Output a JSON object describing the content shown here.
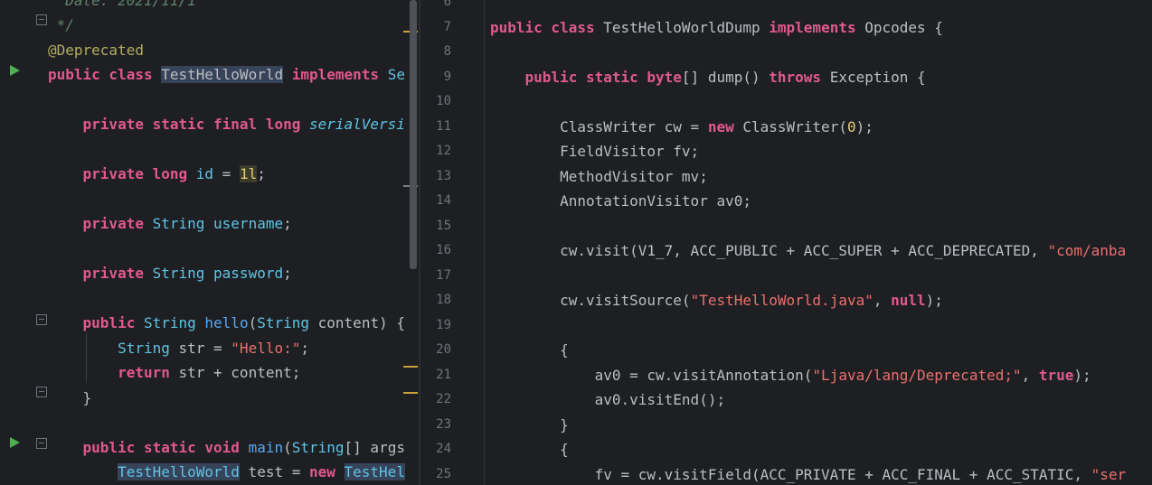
{
  "left_editor": {
    "lines": [
      {
        "parts": [
          {
            "t": "  Date: 2021/11/1",
            "c": "cmt"
          }
        ]
      },
      {
        "parts": [
          {
            "t": " */",
            "c": "cmt"
          }
        ]
      },
      {
        "parts": [
          {
            "t": "@Deprecated",
            "c": "ann"
          }
        ]
      },
      {
        "parts": [
          {
            "t": "public class ",
            "c": "pkw"
          },
          {
            "t": "TestHelloWorld",
            "c": "hl-ref"
          },
          {
            "t": " implements ",
            "c": "pkw"
          },
          {
            "t": "Se",
            "c": "type"
          }
        ]
      },
      {
        "parts": []
      },
      {
        "parts": [
          {
            "t": "    private static final long ",
            "c": "pkw"
          },
          {
            "t": "serialVersi",
            "c": "type ital"
          }
        ]
      },
      {
        "parts": []
      },
      {
        "parts": [
          {
            "t": "    private long ",
            "c": "pkw"
          },
          {
            "t": "id",
            "c": "type"
          },
          {
            "t": " = "
          },
          {
            "t": "1l",
            "c": "num hl-num"
          },
          {
            "t": ";"
          }
        ]
      },
      {
        "parts": []
      },
      {
        "parts": [
          {
            "t": "    private ",
            "c": "pkw"
          },
          {
            "t": "String",
            "c": "type"
          },
          {
            "t": " "
          },
          {
            "t": "username",
            "c": "type"
          },
          {
            "t": ";"
          }
        ]
      },
      {
        "parts": []
      },
      {
        "parts": [
          {
            "t": "    private ",
            "c": "pkw"
          },
          {
            "t": "String",
            "c": "type"
          },
          {
            "t": " "
          },
          {
            "t": "password",
            "c": "type"
          },
          {
            "t": ";"
          }
        ]
      },
      {
        "parts": []
      },
      {
        "parts": [
          {
            "t": "    public ",
            "c": "pkw"
          },
          {
            "t": "String",
            "c": "type"
          },
          {
            "t": " "
          },
          {
            "t": "hello",
            "c": "fn"
          },
          {
            "t": "("
          },
          {
            "t": "String",
            "c": "type"
          },
          {
            "t": " content) {"
          }
        ]
      },
      {
        "parts": [
          {
            "t": "        "
          },
          {
            "t": "String",
            "c": "type"
          },
          {
            "t": " str = "
          },
          {
            "t": "\"Hello:\"",
            "c": "str2"
          },
          {
            "t": ";"
          }
        ]
      },
      {
        "parts": [
          {
            "t": "        return ",
            "c": "pkw"
          },
          {
            "t": "str + content;"
          }
        ]
      },
      {
        "parts": [
          {
            "t": "    }"
          }
        ]
      },
      {
        "parts": []
      },
      {
        "parts": [
          {
            "t": "    public static void ",
            "c": "pkw"
          },
          {
            "t": "main",
            "c": "fn"
          },
          {
            "t": "("
          },
          {
            "t": "String",
            "c": "type"
          },
          {
            "t": "[] args"
          }
        ]
      },
      {
        "parts": [
          {
            "t": "        "
          },
          {
            "t": "TestHelloWorld",
            "c": "type hl-ref"
          },
          {
            "t": " test = "
          },
          {
            "t": "new ",
            "c": "pkw"
          },
          {
            "t": "TestHel",
            "c": "type hl-ref"
          }
        ]
      }
    ]
  },
  "right_editor": {
    "lines": [
      {
        "n": "6",
        "parts": []
      },
      {
        "n": "7",
        "parts": [
          {
            "t": "public class ",
            "c": "pkw"
          },
          {
            "t": "TestHelloWorldDump "
          },
          {
            "t": "implements ",
            "c": "pkw"
          },
          {
            "t": "Opcodes {"
          }
        ]
      },
      {
        "n": "8",
        "parts": []
      },
      {
        "n": "9",
        "parts": [
          {
            "t": "    public static byte",
            "c": "pkw"
          },
          {
            "t": "[] dump() "
          },
          {
            "t": "throws ",
            "c": "pkw"
          },
          {
            "t": "Exception {"
          }
        ]
      },
      {
        "n": "10",
        "parts": []
      },
      {
        "n": "11",
        "parts": [
          {
            "t": "        ClassWriter cw = "
          },
          {
            "t": "new ",
            "c": "pkw"
          },
          {
            "t": "ClassWriter("
          },
          {
            "t": "0",
            "c": "num"
          },
          {
            "t": ");"
          }
        ]
      },
      {
        "n": "12",
        "parts": [
          {
            "t": "        FieldVisitor fv;"
          }
        ]
      },
      {
        "n": "13",
        "parts": [
          {
            "t": "        MethodVisitor mv;"
          }
        ]
      },
      {
        "n": "14",
        "parts": [
          {
            "t": "        AnnotationVisitor av0;"
          }
        ]
      },
      {
        "n": "15",
        "parts": []
      },
      {
        "n": "16",
        "parts": [
          {
            "t": "        cw.visit(V1_7, ACC_PUBLIC + ACC_SUPER + ACC_DEPRECATED, "
          },
          {
            "t": "\"com/anba",
            "c": "str2"
          }
        ]
      },
      {
        "n": "17",
        "parts": []
      },
      {
        "n": "18",
        "parts": [
          {
            "t": "        cw.visitSource("
          },
          {
            "t": "\"TestHelloWorld.java\"",
            "c": "str2"
          },
          {
            "t": ", "
          },
          {
            "t": "null",
            "c": "pkw"
          },
          {
            "t": ");"
          }
        ]
      },
      {
        "n": "19",
        "parts": []
      },
      {
        "n": "20",
        "parts": [
          {
            "t": "        {"
          }
        ]
      },
      {
        "n": "21",
        "parts": [
          {
            "t": "            av0 = cw.visitAnnotation("
          },
          {
            "t": "\"Ljava/lang/Deprecated;\"",
            "c": "str2"
          },
          {
            "t": ", "
          },
          {
            "t": "true",
            "c": "pkw"
          },
          {
            "t": ");"
          }
        ]
      },
      {
        "n": "22",
        "parts": [
          {
            "t": "            av0.visitEnd();"
          }
        ]
      },
      {
        "n": "23",
        "parts": [
          {
            "t": "        }"
          }
        ]
      },
      {
        "n": "24",
        "parts": [
          {
            "t": "        {"
          }
        ]
      },
      {
        "n": "25",
        "parts": [
          {
            "t": "            fv = cw.visitField(ACC_PRIVATE + ACC_FINAL + ACC_STATIC, "
          },
          {
            "t": "\"ser",
            "c": "str2"
          }
        ]
      }
    ]
  },
  "colors": {
    "background": "#1e1f22",
    "keyword": "#e0598f",
    "type": "#5ec4e6",
    "string": "#ec6f6f",
    "annotation": "#b3ae60",
    "run_icon": "#4caf50"
  }
}
